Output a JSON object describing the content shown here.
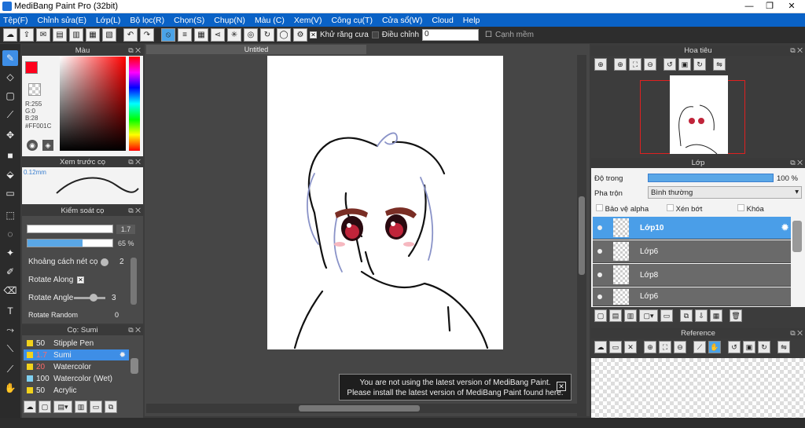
{
  "window": {
    "title": "MediBang Paint Pro (32bit)",
    "minimize": "—",
    "maximize": "❐",
    "close": "✕"
  },
  "menu": [
    "Tệp(F)",
    "Chỉnh sửa(E)",
    "Lớp(L)",
    "Bộ lọc(R)",
    "Chọn(S)",
    "Chụp(N)",
    "Màu (C)",
    "Xem(V)",
    "Công cụ(T)",
    "Cửa sổ(W)",
    "Cloud",
    "Help"
  ],
  "toolbar": {
    "antialias_label": "Khử răng cưa",
    "adjust_label": "Điều chỉnh",
    "adjust_value": "0",
    "smooth_edge_label": "Cạnh mềm"
  },
  "color_panel": {
    "title": "Màu",
    "r": "R:255",
    "g": "G:0",
    "b": "B:28",
    "hex": "#FF001C",
    "color": "#FF001C"
  },
  "brush_preview": {
    "title": "Xem trước cọ",
    "size": "0.12mm"
  },
  "brush_control": {
    "title": "Kiểm soát cọ",
    "size_value": "1.7",
    "opacity_value": "65 %",
    "opacity_fraction": 0.65,
    "spacing_label": "Khoảng cách nét cọ",
    "spacing_value": "2",
    "rotate_along_label": "Rotate Along",
    "rotate_angle_label": "Rotate Angle",
    "rotate_angle_value": "3",
    "rotate_random_label": "Rotate Random",
    "rotate_random_value": "0"
  },
  "brush_list": {
    "title": "Cọ: Sumi",
    "items": [
      {
        "size": "50",
        "name": "Stipple Pen",
        "color": "#f2d21b"
      },
      {
        "size": "1.7",
        "name": "Sumi",
        "color": "#f2d21b"
      },
      {
        "size": "20",
        "name": "Watercolor",
        "color": "#f2d21b"
      },
      {
        "size": "100",
        "name": "Watercolor (Wet)",
        "color": "#7fd0f0"
      },
      {
        "size": "50",
        "name": "Acrylic",
        "color": "#f2d21b"
      }
    ]
  },
  "canvas": {
    "tab_title": "Untitled"
  },
  "notice": {
    "line1": "You are not using the latest version of MediBang Paint.",
    "line2": "Please install the latest version of MediBang Paint found here.",
    "close": "✕"
  },
  "navigator": {
    "title": "Hoa tiêu"
  },
  "layer_panel": {
    "title": "Lớp",
    "opacity_label": "Độ trong",
    "opacity_value": "100 %",
    "blend_label": "Pha trộn",
    "blend_value": "Bình thường",
    "protect_alpha": "Bảo vệ alpha",
    "clipping": "Xén bớt",
    "lock": "Khóa",
    "layers": [
      "Lớp10",
      "Lớp6",
      "Lớp8",
      "Lớp6"
    ]
  },
  "reference": {
    "title": "Reference"
  }
}
